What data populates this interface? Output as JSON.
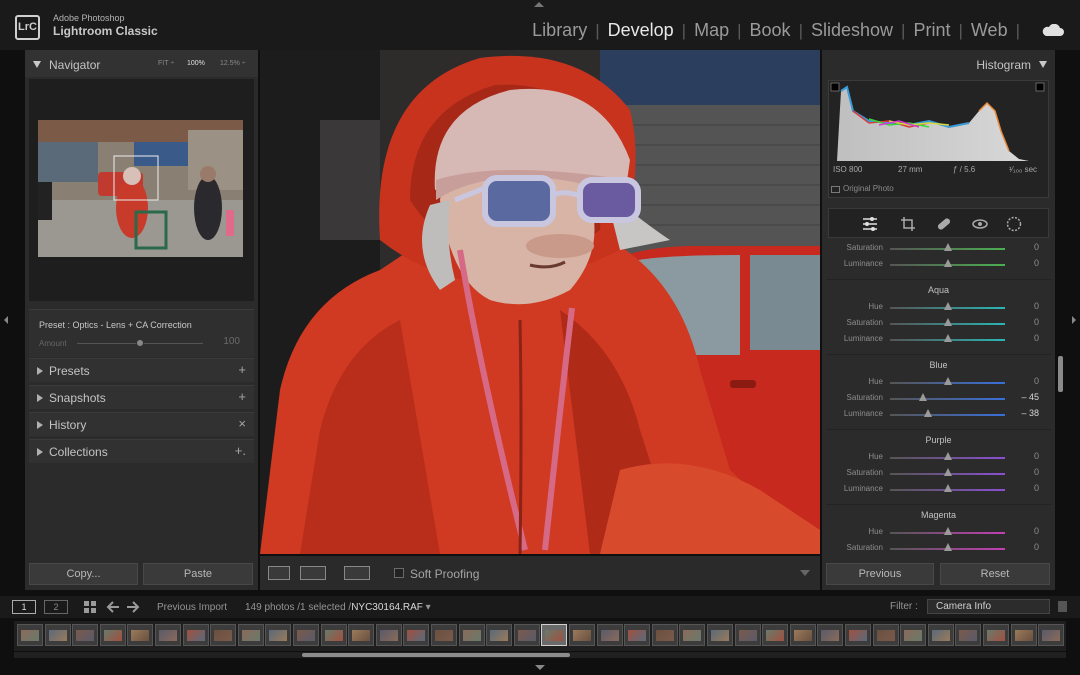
{
  "app": {
    "brand_line1": "Adobe Photoshop",
    "brand_line2": "Lightroom Classic",
    "logo": "LrC"
  },
  "modules": [
    {
      "label": "Library",
      "active": false
    },
    {
      "label": "Develop",
      "active": true
    },
    {
      "label": "Map",
      "active": false
    },
    {
      "label": "Book",
      "active": false
    },
    {
      "label": "Slideshow",
      "active": false
    },
    {
      "label": "Print",
      "active": false
    },
    {
      "label": "Web",
      "active": false
    }
  ],
  "navigator": {
    "title": "Navigator",
    "zoom_fit": "FIT ÷",
    "zoom_100": "100%",
    "zoom_125": "12.5%  ÷"
  },
  "preset": {
    "label": "Preset : Optics - Lens + CA Correction",
    "amount_label": "Amount",
    "amount_value": "100",
    "amount_level": 0.5
  },
  "left_sections": [
    {
      "label": "Presets",
      "action": "+"
    },
    {
      "label": "Snapshots",
      "action": "+"
    },
    {
      "label": "History",
      "action": "×"
    },
    {
      "label": "Collections",
      "action": "+."
    }
  ],
  "left_buttons": {
    "copy": "Copy...",
    "paste": "Paste"
  },
  "toolbar": {
    "soft_proofing": "Soft Proofing"
  },
  "histogram": {
    "title": "Histogram",
    "iso": "ISO 800",
    "focal": "27 mm",
    "aperture": "ƒ / 5.6",
    "shutter": "¹⁄₁₀₀ sec",
    "original_photo": "Original Photo"
  },
  "hsl": {
    "top_rows": [
      {
        "label": "Saturation",
        "value": "0",
        "pos": 0.5,
        "color": "#4caf50"
      },
      {
        "label": "Luminance",
        "value": "0",
        "pos": 0.5,
        "color": "#4caf50"
      }
    ],
    "groups": [
      {
        "name": "Aqua",
        "color": "#2bb5b5",
        "rows": [
          {
            "label": "Hue",
            "value": "0",
            "pos": 0.5
          },
          {
            "label": "Saturation",
            "value": "0",
            "pos": 0.5
          },
          {
            "label": "Luminance",
            "value": "0",
            "pos": 0.5
          }
        ]
      },
      {
        "name": "Blue",
        "color": "#3a6fd8",
        "rows": [
          {
            "label": "Hue",
            "value": "0",
            "pos": 0.5
          },
          {
            "label": "Saturation",
            "value": "– 45",
            "pos": 0.29,
            "strong": true
          },
          {
            "label": "Luminance",
            "value": "– 38",
            "pos": 0.33,
            "strong": true
          }
        ]
      },
      {
        "name": "Purple",
        "color": "#8a4fd0",
        "rows": [
          {
            "label": "Hue",
            "value": "0",
            "pos": 0.5
          },
          {
            "label": "Saturation",
            "value": "0",
            "pos": 0.5
          },
          {
            "label": "Luminance",
            "value": "0",
            "pos": 0.5
          }
        ]
      },
      {
        "name": "Magenta",
        "color": "#c23fb3",
        "rows": [
          {
            "label": "Hue",
            "value": "0",
            "pos": 0.5
          },
          {
            "label": "Saturation",
            "value": "0",
            "pos": 0.5
          }
        ]
      }
    ]
  },
  "right_buttons": {
    "previous": "Previous",
    "reset": "Reset"
  },
  "filmstrip": {
    "screen1": "1",
    "screen2": "2",
    "source": "Previous Import",
    "count": "149 photos /1 selected /",
    "filename": "NYC30164.RAF",
    "filter_label": "Filter :",
    "filter_value": "Camera Info",
    "thumb_count": 38,
    "selected_index": 19
  }
}
